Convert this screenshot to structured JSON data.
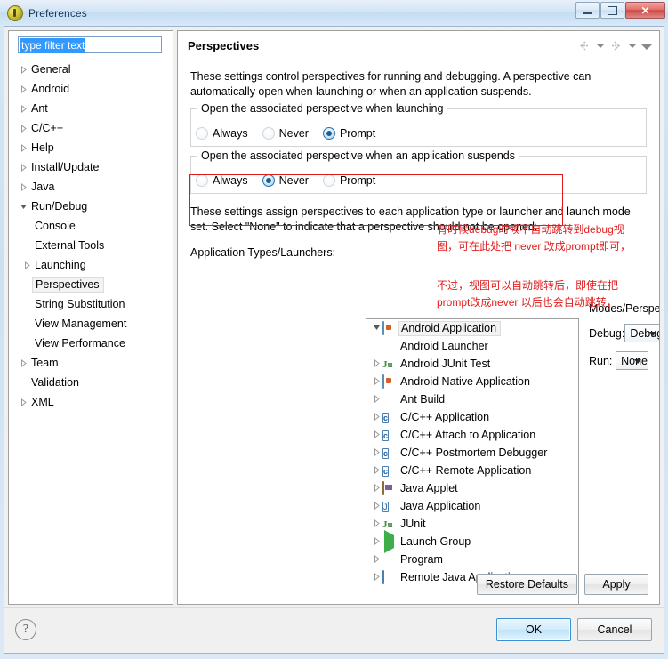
{
  "window": {
    "title": "Preferences",
    "controls": {
      "minimize": "Minimize",
      "maximize": "Maximize",
      "close": "✕"
    }
  },
  "sidebar": {
    "filter": {
      "value": "type filter text",
      "placeholder": "type filter text"
    },
    "items": [
      {
        "label": "General",
        "level": 1,
        "expandable": true,
        "expanded": false,
        "selected": false
      },
      {
        "label": "Android",
        "level": 1,
        "expandable": true,
        "expanded": false,
        "selected": false
      },
      {
        "label": "Ant",
        "level": 1,
        "expandable": true,
        "expanded": false,
        "selected": false
      },
      {
        "label": "C/C++",
        "level": 1,
        "expandable": true,
        "expanded": false,
        "selected": false
      },
      {
        "label": "Help",
        "level": 1,
        "expandable": true,
        "expanded": false,
        "selected": false
      },
      {
        "label": "Install/Update",
        "level": 1,
        "expandable": true,
        "expanded": false,
        "selected": false
      },
      {
        "label": "Java",
        "level": 1,
        "expandable": true,
        "expanded": false,
        "selected": false
      },
      {
        "label": "Run/Debug",
        "level": 1,
        "expandable": true,
        "expanded": true,
        "selected": false
      },
      {
        "label": "Console",
        "level": 2,
        "expandable": false,
        "expanded": false,
        "selected": false
      },
      {
        "label": "External Tools",
        "level": 2,
        "expandable": false,
        "expanded": false,
        "selected": false
      },
      {
        "label": "Launching",
        "level": 2,
        "expandable": true,
        "expanded": false,
        "selected": false
      },
      {
        "label": "Perspectives",
        "level": 2,
        "expandable": false,
        "expanded": false,
        "selected": true
      },
      {
        "label": "String Substitution",
        "level": 2,
        "expandable": false,
        "expanded": false,
        "selected": false
      },
      {
        "label": "View Management",
        "level": 2,
        "expandable": false,
        "expanded": false,
        "selected": false
      },
      {
        "label": "View Performance",
        "level": 2,
        "expandable": false,
        "expanded": false,
        "selected": false
      },
      {
        "label": "Team",
        "level": 1,
        "expandable": true,
        "expanded": false,
        "selected": false
      },
      {
        "label": "Validation",
        "level": 1,
        "expandable": false,
        "expanded": false,
        "selected": false
      },
      {
        "label": "XML",
        "level": 1,
        "expandable": true,
        "expanded": false,
        "selected": false
      }
    ]
  },
  "page": {
    "title": "Perspectives",
    "description_line1": "These settings control perspectives for running and debugging. A perspective can",
    "description_line2": "automatically open when launching or when an application suspends.",
    "launch_group": {
      "title": "Open the associated perspective when launching",
      "options": [
        "Always",
        "Never",
        "Prompt"
      ],
      "selected": "Prompt"
    },
    "suspend_group": {
      "title": "Open the associated perspective when an application suspends",
      "options": [
        "Always",
        "Never",
        "Prompt"
      ],
      "selected": "Never"
    },
    "assign_line1": "These settings assign perspectives to each application type or launcher and launch mode",
    "assign_line2": "set. Select \"None\" to indicate that a perspective should not be opened.",
    "list_label": "Application Types/Launchers:",
    "modes_label": "Modes/Perspectives:",
    "debug_label": "Debug:",
    "debug_value": "Debug",
    "run_label": "Run:",
    "run_value": "None",
    "restore_defaults": "Restore Defaults",
    "apply": "Apply"
  },
  "app_list": [
    {
      "label": "Android Application",
      "icon": "android-icon",
      "expandable": true,
      "expanded": true,
      "selected": true,
      "child": false
    },
    {
      "label": "Android Launcher",
      "icon": "none",
      "expandable": false,
      "expanded": false,
      "selected": false,
      "child": true
    },
    {
      "label": "Android JUnit Test",
      "icon": "junit-icon",
      "expandable": true,
      "expanded": false,
      "selected": false,
      "child": false
    },
    {
      "label": "Android Native Application",
      "icon": "android-icon",
      "expandable": true,
      "expanded": false,
      "selected": false,
      "child": false
    },
    {
      "label": "Ant Build",
      "icon": "ant-icon",
      "expandable": true,
      "expanded": false,
      "selected": false,
      "child": false
    },
    {
      "label": "C/C++ Application",
      "icon": "c-icon",
      "expandable": true,
      "expanded": false,
      "selected": false,
      "child": false
    },
    {
      "label": "C/C++ Attach to Application",
      "icon": "c-icon",
      "expandable": true,
      "expanded": false,
      "selected": false,
      "child": false
    },
    {
      "label": "C/C++ Postmortem Debugger",
      "icon": "c-icon",
      "expandable": true,
      "expanded": false,
      "selected": false,
      "child": false
    },
    {
      "label": "C/C++ Remote Application",
      "icon": "c-icon",
      "expandable": true,
      "expanded": false,
      "selected": false,
      "child": false
    },
    {
      "label": "Java Applet",
      "icon": "applet-icon",
      "expandable": true,
      "expanded": false,
      "selected": false,
      "child": false
    },
    {
      "label": "Java Application",
      "icon": "java-icon",
      "expandable": true,
      "expanded": false,
      "selected": false,
      "child": false
    },
    {
      "label": "JUnit",
      "icon": "junit-icon",
      "expandable": true,
      "expanded": false,
      "selected": false,
      "child": false
    },
    {
      "label": "Launch Group",
      "icon": "play-icon",
      "expandable": true,
      "expanded": false,
      "selected": false,
      "child": false
    },
    {
      "label": "Program",
      "icon": "program-icon",
      "expandable": true,
      "expanded": false,
      "selected": false,
      "child": false
    },
    {
      "label": "Remote Java Application",
      "icon": "remote-java-icon",
      "expandable": true,
      "expanded": false,
      "selected": false,
      "child": false
    }
  ],
  "annotation": {
    "color": "#e02020",
    "line1": "有时候debug时候不自动跳转到debug视",
    "line2": "图，可在此处把 never 改成prompt即可，",
    "line3": "不过，视图可以自动跳转后，即使在把",
    "line4": "prompt改成never 以后也会自动跳转，"
  },
  "footer": {
    "help": "?",
    "ok": "OK",
    "cancel": "Cancel"
  }
}
